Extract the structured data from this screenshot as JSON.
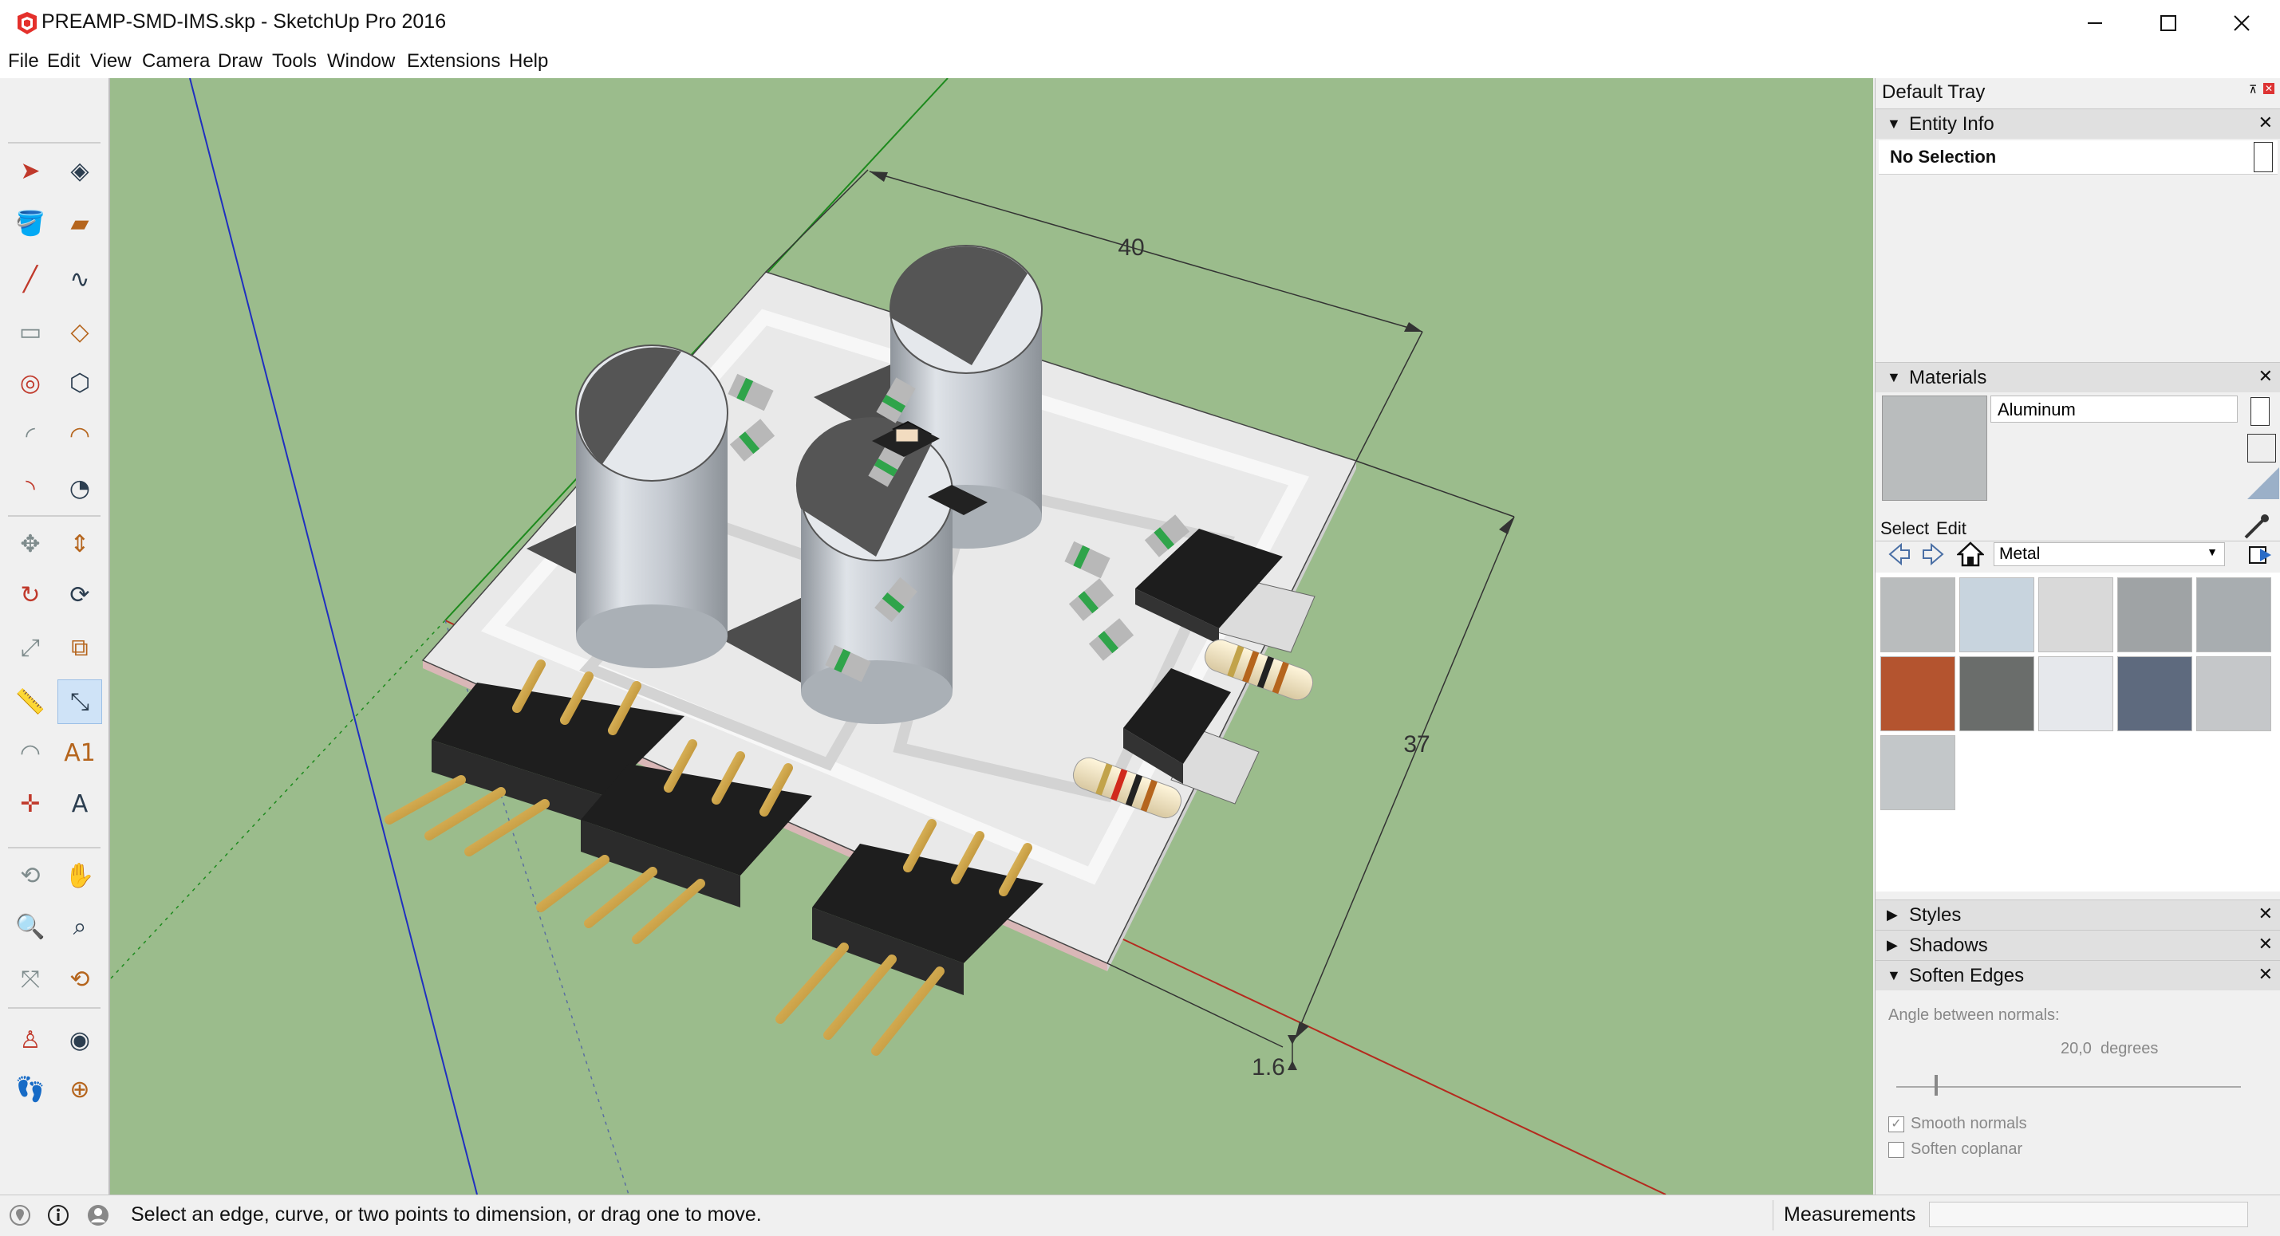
{
  "window": {
    "title": "PREAMP-SMD-IMS.skp - SketchUp Pro 2016",
    "minimize_glyph": "—",
    "maximize_glyph": "☐",
    "close_glyph": "✕"
  },
  "menu": [
    "File",
    "Edit",
    "View",
    "Camera",
    "Draw",
    "Tools",
    "Window",
    "Extensions",
    "Help"
  ],
  "toolbar": {
    "tools": [
      "select-icon",
      "make-component-icon",
      "paint-bucket-icon",
      "eraser-icon",
      "line-icon",
      "freehand-icon",
      "rectangle-icon",
      "rotated-rectangle-icon",
      "circle-icon",
      "polygon-icon",
      "arc-icon",
      "two-point-arc-icon",
      "three-point-arc-icon",
      "pie-icon",
      "move-icon",
      "push-pull-icon",
      "rotate-icon",
      "follow-me-icon",
      "scale-icon",
      "offset-icon",
      "tape-measure-icon",
      "dimension-icon",
      "protractor-icon",
      "text-icon",
      "axes-icon",
      "3d-text-icon",
      "orbit-icon",
      "pan-icon",
      "zoom-icon",
      "zoom-window-icon",
      "zoom-extents-icon",
      "previous-view-icon",
      "position-camera-icon",
      "look-around-icon",
      "walk-icon",
      "section-plane-icon"
    ],
    "active_tool": "dimension-icon"
  },
  "viewport": {
    "dimensions": {
      "width_label": "40",
      "depth_label": "37",
      "thickness_label": "1.6"
    }
  },
  "tray": {
    "title": "Default Tray",
    "pin_glyph": "⊼",
    "entity_info": {
      "header": "Entity Info",
      "selection": "No Selection"
    },
    "materials": {
      "header": "Materials",
      "material_name": "Aluminum",
      "tab_select": "Select",
      "tab_edit": "Edit",
      "library": "Metal",
      "swatches": [
        "#b9bcbd",
        "#c8d4de",
        "#d9d9d9",
        "#9fa3a5",
        "#a8adb0",
        "#b4542f",
        "#6a6d6b",
        "#e6e8ec",
        "#5e6a7e",
        "#c5c7c9",
        "#c3c7c9"
      ]
    },
    "styles": {
      "header": "Styles"
    },
    "shadows": {
      "header": "Shadows"
    },
    "soften_edges": {
      "header": "Soften Edges",
      "angle_label": "Angle between normals:",
      "angle_value": "20,0  degrees",
      "smooth_normals": "Smooth normals",
      "soften_coplanar": "Soften coplanar",
      "smooth_checked": true,
      "coplanar_checked": false,
      "slider_fraction": 0.11
    },
    "close_glyph": "✕",
    "expand_glyph": "▼",
    "collapse_glyph": "▶"
  },
  "statusbar": {
    "message": "Select an edge, curve, or two points to dimension, or drag one to move.",
    "measurements_label": "Measurements",
    "measurements_value": ""
  }
}
